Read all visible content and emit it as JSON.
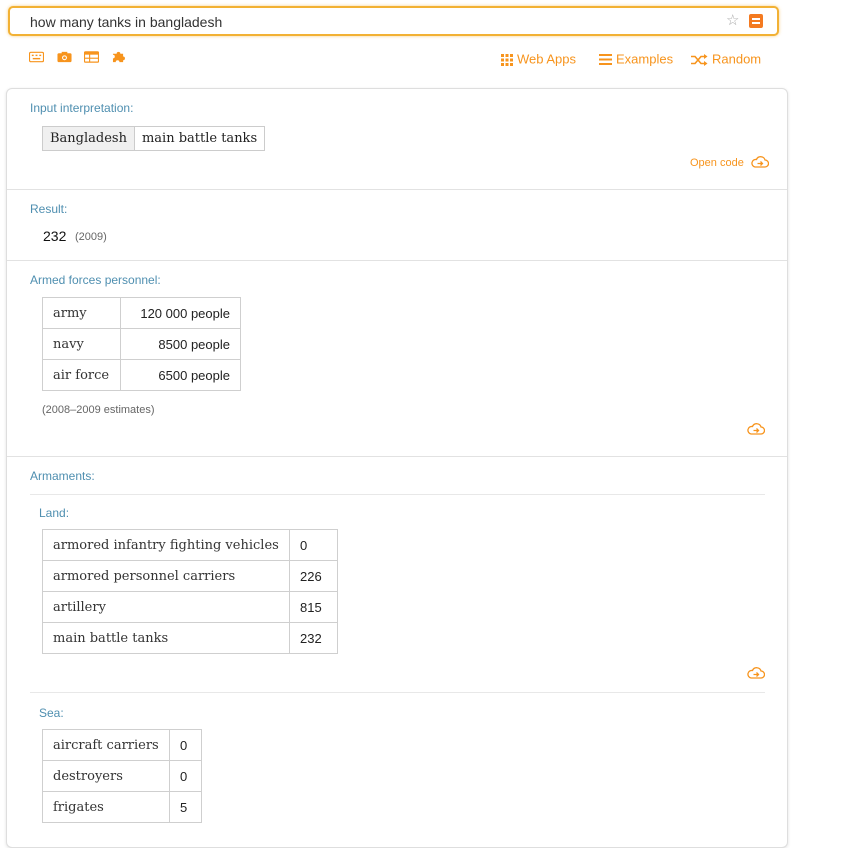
{
  "search": {
    "query": "how many tanks in bangladesh"
  },
  "toolbar": {
    "icons": [
      "keyboard-icon",
      "camera-icon",
      "table-icon",
      "puzzle-icon"
    ]
  },
  "nav": {
    "web_apps": "Web Apps",
    "examples": "Examples",
    "random": "Random"
  },
  "pods": {
    "input_interpretation": {
      "title": "Input interpretation:",
      "terms": [
        "Bangladesh",
        "main battle tanks"
      ],
      "open_code": "Open code"
    },
    "result": {
      "title": "Result:",
      "value": "232",
      "note": "(2009)"
    },
    "personnel": {
      "title": "Armed forces personnel:",
      "rows": [
        {
          "label": "army",
          "value": "120 000 people"
        },
        {
          "label": "navy",
          "value": "8500 people"
        },
        {
          "label": "air force",
          "value": "6500 people"
        }
      ],
      "note": "(2008–2009 estimates)"
    },
    "armaments": {
      "title": "Armaments:",
      "land": {
        "title": "Land:",
        "rows": [
          {
            "label": "armored infantry fighting vehicles",
            "value": "0"
          },
          {
            "label": "armored personnel carriers",
            "value": "226"
          },
          {
            "label": "artillery",
            "value": "815"
          },
          {
            "label": "main battle tanks",
            "value": "232"
          }
        ]
      },
      "sea": {
        "title": "Sea:",
        "rows": [
          {
            "label": "aircraft carriers",
            "value": "0"
          },
          {
            "label": "destroyers",
            "value": "0"
          },
          {
            "label": "frigates",
            "value": "5"
          }
        ]
      }
    }
  },
  "colors": {
    "accent": "#f7941d",
    "pod_title": "#4f8fb0",
    "search_border": "#f2b134"
  }
}
